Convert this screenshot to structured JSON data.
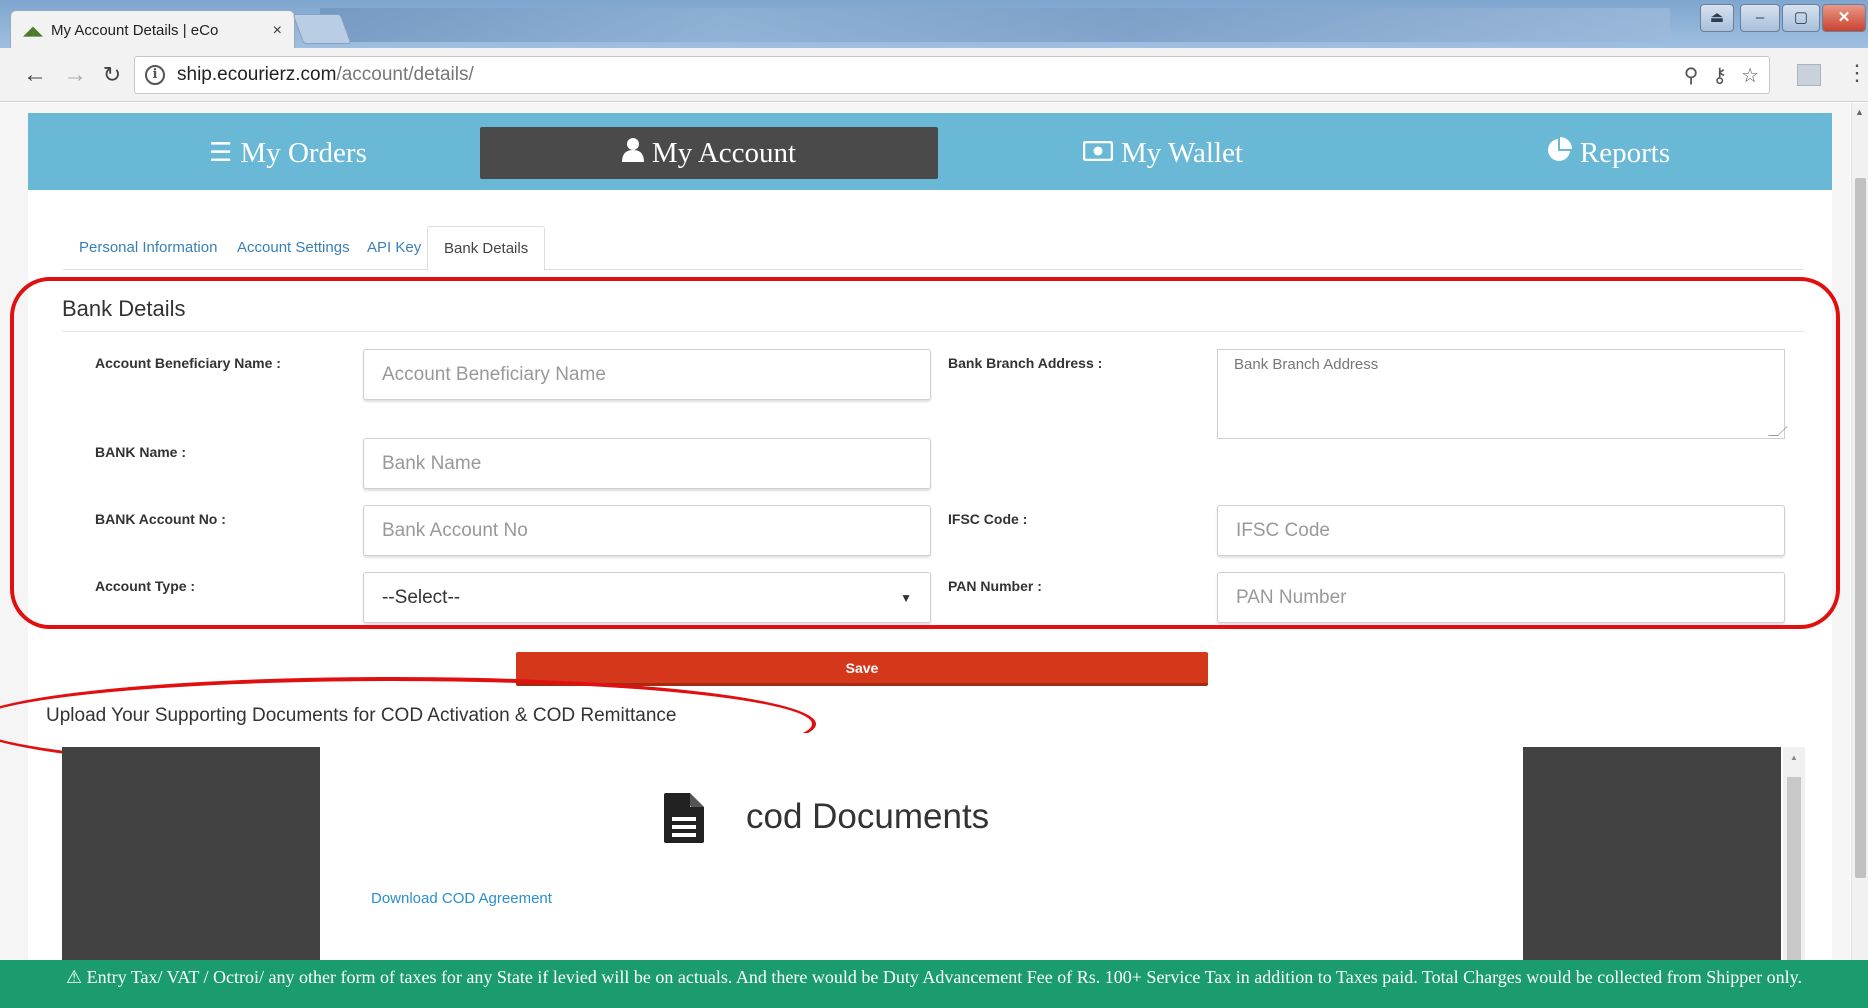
{
  "browser": {
    "tab_title": "My Account Details | eCo",
    "tab_close": "×",
    "url_host": "ship.ecourierz.com",
    "url_path": "/account/details/"
  },
  "main_nav": {
    "items": [
      {
        "label": "My Orders",
        "icon": "list-icon"
      },
      {
        "label": "My Account",
        "icon": "user-icon",
        "active": true
      },
      {
        "label": "My Wallet",
        "icon": "money-icon"
      },
      {
        "label": "Reports",
        "icon": "pie-chart-icon"
      }
    ]
  },
  "sub_tabs": [
    {
      "label": "Personal Information"
    },
    {
      "label": "Account Settings"
    },
    {
      "label": "API Key"
    },
    {
      "label": "Bank Details",
      "active": true
    }
  ],
  "bank_details": {
    "title": "Bank Details",
    "fields": {
      "beneficiary": {
        "label": "Account Beneficiary Name :",
        "placeholder": "Account Beneficiary Name"
      },
      "branch_address": {
        "label": "Bank Branch Address :",
        "placeholder": "Bank Branch Address"
      },
      "bank_name": {
        "label": "BANK Name :",
        "placeholder": "Bank Name"
      },
      "account_no": {
        "label": "BANK Account No :",
        "placeholder": "Bank Account No"
      },
      "ifsc": {
        "label": "IFSC Code :",
        "placeholder": "IFSC Code"
      },
      "account_type": {
        "label": "Account Type :",
        "value": "--Select--"
      },
      "pan": {
        "label": "PAN Number :",
        "placeholder": "PAN Number"
      }
    },
    "save_label": "Save"
  },
  "upload": {
    "title": "Upload Your Supporting Documents for COD Activation & COD Remittance",
    "doc_title": "cod Documents",
    "download_link": "Download COD Agreement"
  },
  "notice": {
    "text": "Entry Tax/ VAT / Octroi/ any other form of taxes for any State if levied will be on actuals. And there would be Duty Advancement Fee of Rs. 100+ Service Tax in addition to Taxes paid. Total Charges would be collected from Shipper only."
  },
  "colors": {
    "nav_bar": "#69b8d6",
    "nav_active": "#4a4a4a",
    "save_button": "#d4371a",
    "link": "#3a7fb5",
    "notice_bar": "#1b9c6e",
    "annotation_red": "#e01010"
  }
}
